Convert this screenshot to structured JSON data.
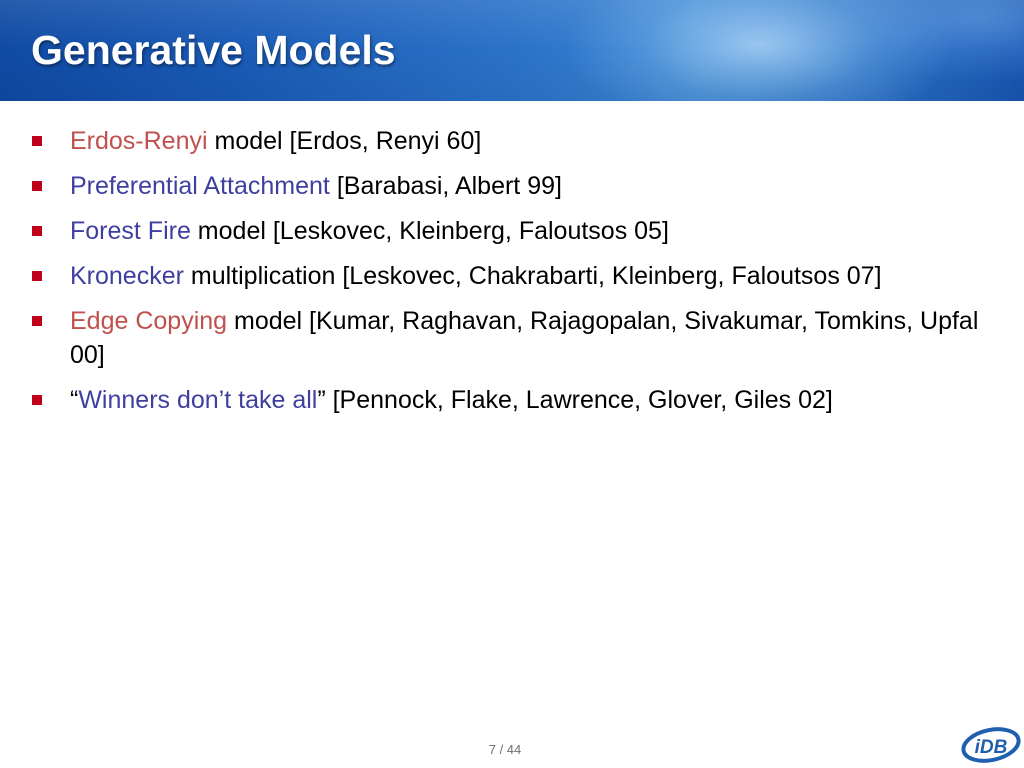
{
  "slide": {
    "title": "Generative Models",
    "bullets": [
      {
        "highlight": "Erdos-Renyi",
        "highlight_color": "red",
        "rest": " model [Erdos, Renyi 60]"
      },
      {
        "highlight": "Preferential Attachment",
        "highlight_color": "blue",
        "rest": " [Barabasi, Albert 99]"
      },
      {
        "highlight": "Forest Fire",
        "highlight_color": "blue",
        "rest": " model [Leskovec, Kleinberg, Faloutsos 05]"
      },
      {
        "highlight": "Kronecker",
        "highlight_color": "blue",
        "rest": " multiplication [Leskovec, Chakrabarti, Kleinberg, Faloutsos 07]"
      },
      {
        "highlight": "Edge Copying",
        "highlight_color": "red",
        "rest": " model [Kumar, Raghavan, Rajagopalan, Sivakumar, Tomkins, Upfal 00]"
      },
      {
        "prefix": "“",
        "highlight": "Winners don’t take all",
        "highlight_color": "blue",
        "rest": "” [Pennock, Flake, Lawrence, Glover, Giles 02]"
      }
    ],
    "page_number": "7 / 44"
  },
  "logo": {
    "text": "iDB",
    "icon": "idb-logo-icon"
  },
  "colors": {
    "header_blue": "#1a5cb8",
    "bullet_marker": "#c0001a",
    "highlight_red": "#c0504d",
    "highlight_blue": "#3f3f9f",
    "logo_blue": "#1f5fae"
  }
}
